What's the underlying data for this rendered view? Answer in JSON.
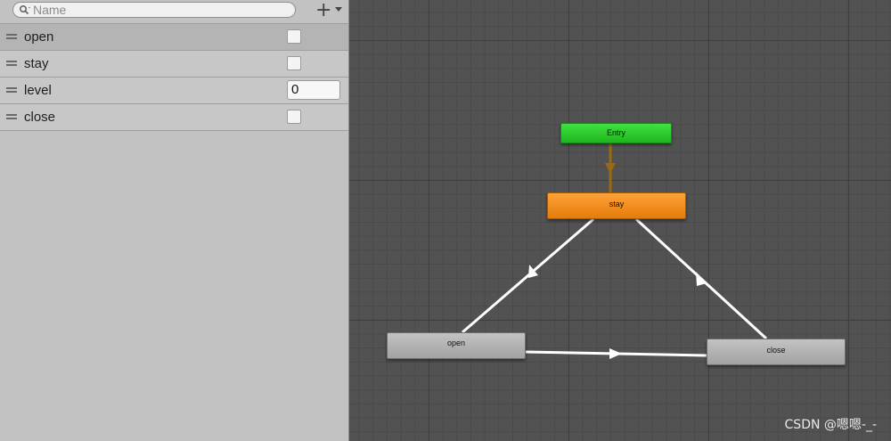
{
  "parameters_panel": {
    "search": {
      "placeholder": "Name",
      "value": ""
    },
    "add_button": {
      "icon": "plus-icon",
      "dropdown_icon": "chevron-down-icon"
    },
    "items": [
      {
        "label": "open",
        "type": "bool",
        "checked": false,
        "selected": true
      },
      {
        "label": "stay",
        "type": "bool",
        "checked": false
      },
      {
        "label": "level",
        "type": "int",
        "value": "0"
      },
      {
        "label": "close",
        "type": "bool",
        "checked": false
      }
    ]
  },
  "graph": {
    "states": {
      "entry": {
        "label": "Entry",
        "color": "#2ecc2e"
      },
      "stay": {
        "label": "stay",
        "color": "#f59020"
      },
      "open": {
        "label": "open",
        "color": "#b0b0b0"
      },
      "close": {
        "label": "close",
        "color": "#b0b0b0"
      }
    },
    "transitions": [
      {
        "from": "Entry",
        "to": "stay",
        "color": "#9a6a10"
      },
      {
        "from": "stay",
        "to": "open",
        "color": "#ffffff"
      },
      {
        "from": "open",
        "to": "close",
        "color": "#ffffff"
      },
      {
        "from": "close",
        "to": "stay",
        "color": "#ffffff"
      }
    ]
  },
  "watermark": "CSDN @嗯嗯-_-"
}
